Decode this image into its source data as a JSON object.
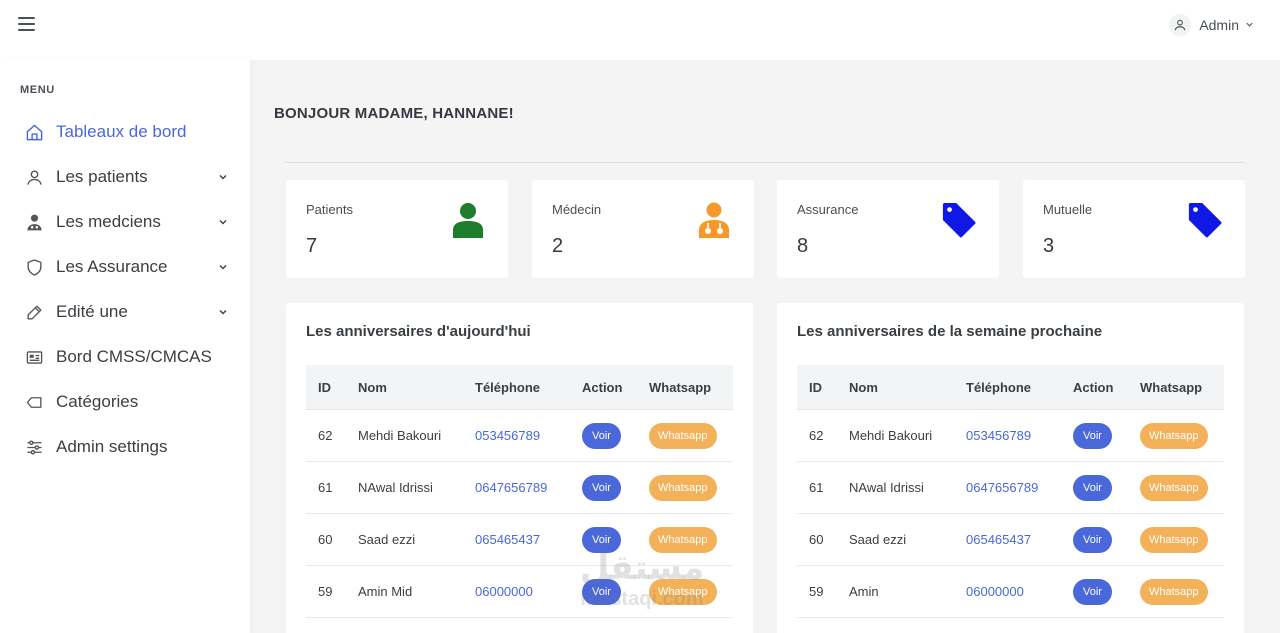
{
  "header": {
    "user_name": "Admin"
  },
  "sidebar": {
    "menu_title": "MENU",
    "items": [
      {
        "label": "Tableaux de bord",
        "icon": "home-icon",
        "active": true,
        "has_caret": false
      },
      {
        "label": "Les patients",
        "icon": "user-icon",
        "active": false,
        "has_caret": true
      },
      {
        "label": "Les medciens",
        "icon": "doctor-icon",
        "active": false,
        "has_caret": true
      },
      {
        "label": "Les Assurance",
        "icon": "shield-icon",
        "active": false,
        "has_caret": true
      },
      {
        "label": "Edité une",
        "icon": "edit-icon",
        "active": false,
        "has_caret": true
      },
      {
        "label": "Bord CMSS/CMCAS",
        "icon": "id-card-icon",
        "active": false,
        "has_caret": false
      },
      {
        "label": "Catégories",
        "icon": "tag-outline-icon",
        "active": false,
        "has_caret": false
      },
      {
        "label": "Admin settings",
        "icon": "sliders-icon",
        "active": false,
        "has_caret": false
      }
    ]
  },
  "greeting": "BONJOUR MADAME, HANNANE!",
  "stats": [
    {
      "label": "Patients",
      "value": "7",
      "icon": "user-icon",
      "color": "#1e7d2c"
    },
    {
      "label": "Médecin",
      "value": "2",
      "icon": "doctor-icon",
      "color": "#f59a2a"
    },
    {
      "label": "Assurance",
      "value": "8",
      "icon": "tag-icon",
      "color": "#1018e6"
    },
    {
      "label": "Mutuelle",
      "value": "3",
      "icon": "tag-icon",
      "color": "#1018e6"
    }
  ],
  "tables": [
    {
      "title": "Les anniversaires d'aujourd'hui",
      "columns": [
        "ID",
        "Nom",
        "Téléphone",
        "Action",
        "Whatsapp"
      ],
      "rows": [
        {
          "id": "62",
          "nom": "Mehdi Bakouri",
          "tel": "053456789",
          "action": "Voir",
          "whatsapp": "Whatsapp"
        },
        {
          "id": "61",
          "nom": "NAwal Idrissi",
          "tel": "0647656789",
          "action": "Voir",
          "whatsapp": "Whatsapp"
        },
        {
          "id": "60",
          "nom": "Saad ezzi",
          "tel": "065465437",
          "action": "Voir",
          "whatsapp": "Whatsapp"
        },
        {
          "id": "59",
          "nom": "Amin Mid",
          "tel": "06000000",
          "action": "Voir",
          "whatsapp": "Whatsapp"
        }
      ]
    },
    {
      "title": "Les anniversaires de la semaine prochaine",
      "columns": [
        "ID",
        "Nom",
        "Téléphone",
        "Action",
        "Whatsapp"
      ],
      "rows": [
        {
          "id": "62",
          "nom": "Mehdi Bakouri",
          "tel": "053456789",
          "action": "Voir",
          "whatsapp": "Whatsapp"
        },
        {
          "id": "61",
          "nom": "NAwal Idrissi",
          "tel": "0647656789",
          "action": "Voir",
          "whatsapp": "Whatsapp"
        },
        {
          "id": "60",
          "nom": "Saad ezzi",
          "tel": "065465437",
          "action": "Voir",
          "whatsapp": "Whatsapp"
        },
        {
          "id": "59",
          "nom": "Amin",
          "tel": "06000000",
          "action": "Voir",
          "whatsapp": "Whatsapp"
        }
      ]
    }
  ],
  "watermark": {
    "arabic": "مستقل",
    "latin": "mostaqi.com"
  },
  "colors": {
    "accent": "#4a68d9",
    "whatsapp": "#f3b15a",
    "sidebar_bg": "#ffffff",
    "page_bg": "#f4f4f5"
  }
}
